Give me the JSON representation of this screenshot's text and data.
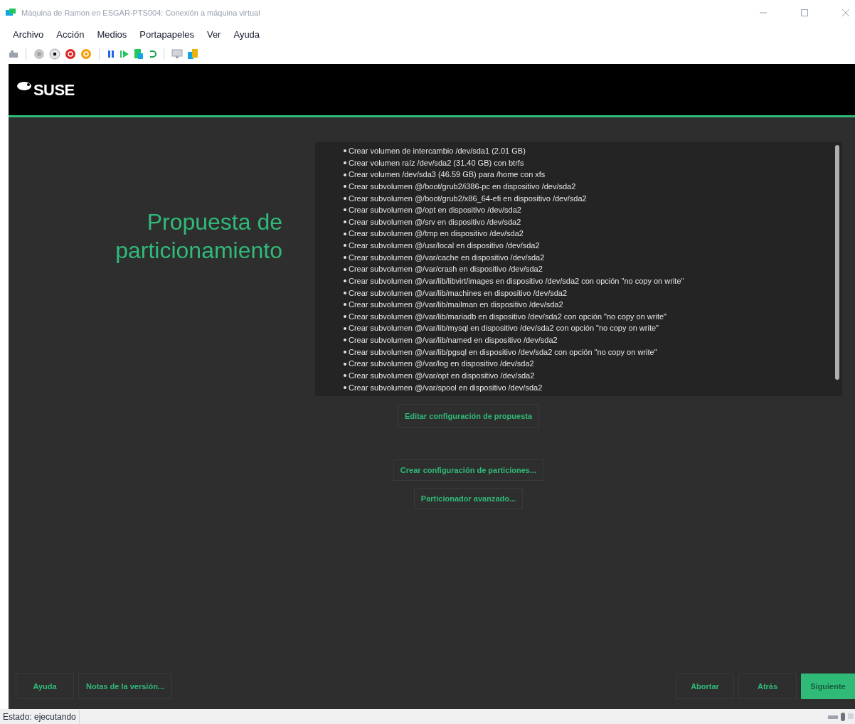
{
  "window": {
    "title": "Máquina de Ramon en ESGAR-PTS004: Conexión a máquina virtual"
  },
  "menu": [
    "Archivo",
    "Acción",
    "Medios",
    "Portapapeles",
    "Ver",
    "Ayuda"
  ],
  "toolbar": [
    {
      "kind": "ctrlaltdel"
    },
    {
      "kind": "sep"
    },
    {
      "kind": "start"
    },
    {
      "kind": "stop"
    },
    {
      "kind": "shutdown"
    },
    {
      "kind": "save"
    },
    {
      "kind": "sep"
    },
    {
      "kind": "pause"
    },
    {
      "kind": "resume"
    },
    {
      "kind": "checkpoint"
    },
    {
      "kind": "revert"
    },
    {
      "kind": "sep"
    },
    {
      "kind": "enhanced"
    },
    {
      "kind": "share"
    }
  ],
  "installer": {
    "logo": "SUSE",
    "heading": "Propuesta de particionamiento",
    "proposal": [
      "Crear volumen de intercambio /dev/sda1 (2.01 GB)",
      "Crear volumen raíz /dev/sda2 (31.40 GB) con btrfs",
      "Crear volumen /dev/sda3 (46.59 GB) para /home con xfs",
      "Crear subvolumen @/boot/grub2/i386-pc en dispositivo /dev/sda2",
      "Crear subvolumen @/boot/grub2/x86_64-efi en dispositivo /dev/sda2",
      "Crear subvolumen @/opt en dispositivo /dev/sda2",
      "Crear subvolumen @/srv en dispositivo /dev/sda2",
      "Crear subvolumen @/tmp en dispositivo /dev/sda2",
      "Crear subvolumen @/usr/local en dispositivo /dev/sda2",
      "Crear subvolumen @/var/cache en dispositivo /dev/sda2",
      "Crear subvolumen @/var/crash en dispositivo /dev/sda2",
      "Crear subvolumen @/var/lib/libvirt/images en dispositivo /dev/sda2 con opción \"no copy on write\"",
      "Crear subvolumen @/var/lib/machines en dispositivo /dev/sda2",
      "Crear subvolumen @/var/lib/mailman en dispositivo /dev/sda2",
      "Crear subvolumen @/var/lib/mariadb en dispositivo /dev/sda2 con opción \"no copy on write\"",
      "Crear subvolumen @/var/lib/mysql en dispositivo /dev/sda2 con opción \"no copy on write\"",
      "Crear subvolumen @/var/lib/named en dispositivo /dev/sda2",
      "Crear subvolumen @/var/lib/pgsql en dispositivo /dev/sda2 con opción \"no copy on write\"",
      "Crear subvolumen @/var/log en dispositivo /dev/sda2",
      "Crear subvolumen @/var/opt en dispositivo /dev/sda2",
      "Crear subvolumen @/var/spool en dispositivo /dev/sda2"
    ],
    "actions": [
      "Editar configuración de propuesta",
      "Crear configuración de particiones...",
      "Particionador avanzado..."
    ],
    "footer_left": [
      "Ayuda",
      "Notas de la versión..."
    ],
    "footer_right": [
      {
        "label": "Abortar",
        "primary": false
      },
      {
        "label": "Atrás",
        "primary": false
      },
      {
        "label": "Siguiente",
        "primary": true
      }
    ]
  },
  "status_bar": {
    "text": "Estado: ejecutando"
  }
}
